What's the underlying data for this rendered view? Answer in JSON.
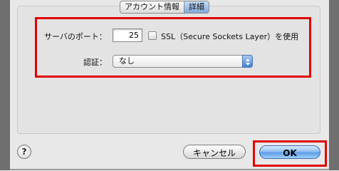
{
  "tabs": {
    "account_info": "アカウント情報",
    "details": "詳細"
  },
  "form": {
    "server_port_label": "サーバのポート：",
    "server_port_value": "25",
    "ssl_label": "SSL（Secure Sockets Layer）を使用",
    "ssl_checked": false,
    "auth_label": "認証：",
    "auth_value": "なし"
  },
  "buttons": {
    "help": "?",
    "cancel": "キャンセル",
    "ok": "OK"
  },
  "colors": {
    "highlight": "#e00000",
    "ok_button": "#5e9ee6"
  }
}
